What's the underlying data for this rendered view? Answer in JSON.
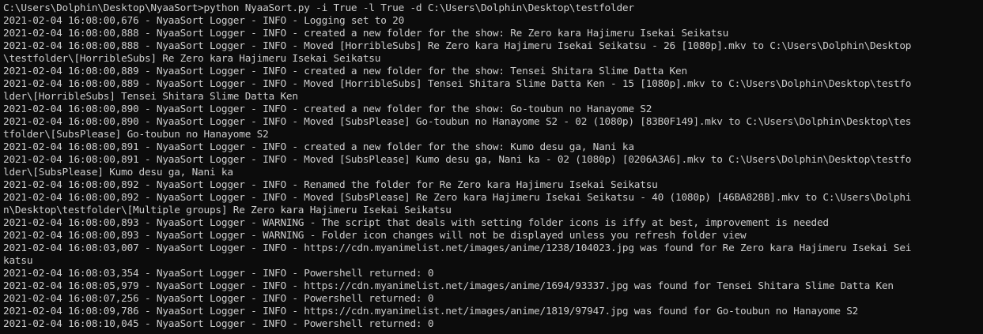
{
  "terminal": {
    "lines": [
      "C:\\Users\\Dolphin\\Desktop\\NyaaSort>python NyaaSort.py -i True -l True -d C:\\Users\\Dolphin\\Desktop\\testfolder",
      "2021-02-04 16:08:00,676 - NyaaSort Logger - INFO - Logging set to 20",
      "2021-02-04 16:08:00,888 - NyaaSort Logger - INFO - created a new folder for the show: Re Zero kara Hajimeru Isekai Seikatsu",
      "2021-02-04 16:08:00,888 - NyaaSort Logger - INFO - Moved [HorribleSubs] Re Zero kara Hajimeru Isekai Seikatsu - 26 [1080p].mkv to C:\\Users\\Dolphin\\Desktop",
      "\\testfolder\\[HorribleSubs] Re Zero kara Hajimeru Isekai Seikatsu",
      "2021-02-04 16:08:00,889 - NyaaSort Logger - INFO - created a new folder for the show: Tensei Shitara Slime Datta Ken",
      "2021-02-04 16:08:00,889 - NyaaSort Logger - INFO - Moved [HorribleSubs] Tensei Shitara Slime Datta Ken - 15 [1080p].mkv to C:\\Users\\Dolphin\\Desktop\\testfo",
      "lder\\[HorribleSubs] Tensei Shitara Slime Datta Ken",
      "2021-02-04 16:08:00,890 - NyaaSort Logger - INFO - created a new folder for the show: Go-toubun no Hanayome S2",
      "2021-02-04 16:08:00,890 - NyaaSort Logger - INFO - Moved [SubsPlease] Go-toubun no Hanayome S2 - 02 (1080p) [83B0F149].mkv to C:\\Users\\Dolphin\\Desktop\\tes",
      "tfolder\\[SubsPlease] Go-toubun no Hanayome S2",
      "2021-02-04 16:08:00,891 - NyaaSort Logger - INFO - created a new folder for the show: Kumo desu ga, Nani ka",
      "2021-02-04 16:08:00,891 - NyaaSort Logger - INFO - Moved [SubsPlease] Kumo desu ga, Nani ka - 02 (1080p) [0206A3A6].mkv to C:\\Users\\Dolphin\\Desktop\\testfo",
      "lder\\[SubsPlease] Kumo desu ga, Nani ka",
      "2021-02-04 16:08:00,892 - NyaaSort Logger - INFO - Renamed the folder for Re Zero kara Hajimeru Isekai Seikatsu",
      "2021-02-04 16:08:00,892 - NyaaSort Logger - INFO - Moved [SubsPlease] Re Zero kara Hajimeru Isekai Seikatsu - 40 (1080p) [46BA828B].mkv to C:\\Users\\Dolphi",
      "n\\Desktop\\testfolder\\[Multiple groups] Re Zero kara Hajimeru Isekai Seikatsu",
      "2021-02-04 16:08:00,893 - NyaaSort Logger - WARNING - The script that deals with setting folder icons is iffy at best, improvement is needed",
      "2021-02-04 16:08:00,893 - NyaaSort Logger - WARNING - Folder icon changes will not be displayed unless you refresh folder view",
      "2021-02-04 16:08:03,007 - NyaaSort Logger - INFO - https://cdn.myanimelist.net/images/anime/1238/104023.jpg was found for Re Zero kara Hajimeru Isekai Sei",
      "katsu",
      "2021-02-04 16:08:03,354 - NyaaSort Logger - INFO - Powershell returned: 0",
      "2021-02-04 16:08:05,979 - NyaaSort Logger - INFO - https://cdn.myanimelist.net/images/anime/1694/93337.jpg was found for Tensei Shitara Slime Datta Ken",
      "2021-02-04 16:08:07,256 - NyaaSort Logger - INFO - Powershell returned: 0",
      "2021-02-04 16:08:09,786 - NyaaSort Logger - INFO - https://cdn.myanimelist.net/images/anime/1819/97947.jpg was found for Go-toubun no Hanayome S2",
      "2021-02-04 16:08:10,045 - NyaaSort Logger - INFO - Powershell returned: 0"
    ]
  },
  "colors": {
    "background": "#0c0c0c",
    "text": "#cccccc"
  }
}
